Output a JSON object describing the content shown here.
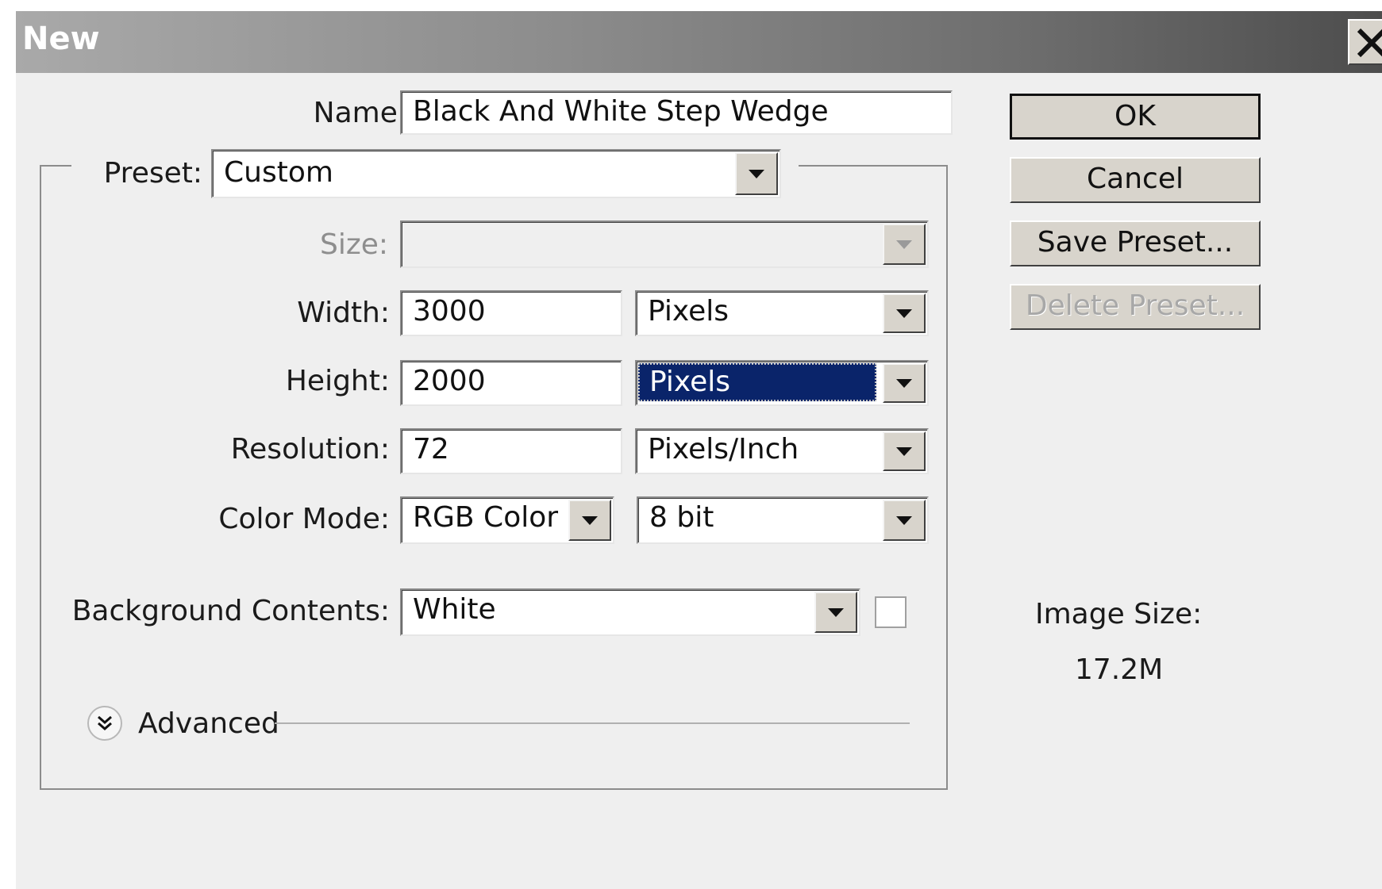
{
  "window": {
    "title": "New",
    "close_icon": "close-icon"
  },
  "form": {
    "name_label": "Name:",
    "name_value": "Black And White Step Wedge",
    "preset_label": "Preset:",
    "preset_value": "Custom",
    "size_label": "Size:",
    "size_value": "",
    "width_label": "Width:",
    "width_value": "3000",
    "width_unit": "Pixels",
    "height_label": "Height:",
    "height_value": "2000",
    "height_unit": "Pixels",
    "resolution_label": "Resolution:",
    "resolution_value": "72",
    "resolution_unit": "Pixels/Inch",
    "color_mode_label": "Color Mode:",
    "color_mode_value": "RGB Color",
    "bit_depth_value": "8 bit",
    "background_label": "Background Contents:",
    "background_value": "White",
    "advanced_label": "Advanced"
  },
  "buttons": {
    "ok": "OK",
    "cancel": "Cancel",
    "save_preset": "Save Preset...",
    "delete_preset": "Delete Preset..."
  },
  "info": {
    "image_size_label": "Image Size:",
    "image_size_value": "17.2M"
  },
  "colors": {
    "selection": "#0a246a",
    "dialog_bg": "#efefef",
    "button_face": "#d8d4cc"
  }
}
